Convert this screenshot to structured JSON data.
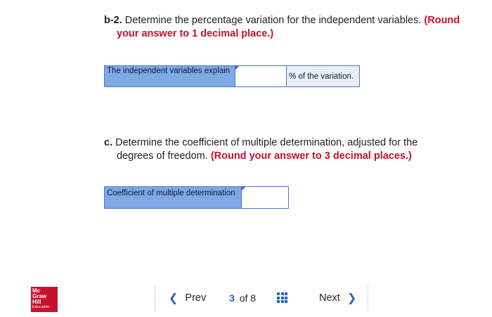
{
  "b2": {
    "number": "b-2.",
    "text": " Determine the percentage variation for the independent variables.",
    "instruction_line1": "(Round",
    "instruction_line2": "your answer to 1 decimal place.)",
    "label": "The independent variables explain",
    "input_value": "",
    "suffix": "% of the variation."
  },
  "c": {
    "number": "c.",
    "text_line1": " Determine the coefficient of multiple determination, adjusted for the",
    "text_line2": "degrees of freedom.",
    "instruction": "(Round your answer to 3 decimal places.)",
    "label": "Coefficient of multiple determination",
    "input_value": ""
  },
  "logo": {
    "line1": "Mc",
    "line2": "Graw",
    "line3": "Hill",
    "line4": "Education"
  },
  "nav": {
    "prev": "Prev",
    "next": "Next",
    "current_page": "3",
    "of_label": "of 8"
  },
  "colors": {
    "accent": "#2a62c4",
    "label_bg": "#7fa9e6",
    "instruction_red": "#c8102e",
    "brand_red": "#c8102e"
  },
  "icons": {
    "prev": "chevron-left-icon",
    "next": "chevron-right-icon",
    "grid": "grid-icon"
  }
}
